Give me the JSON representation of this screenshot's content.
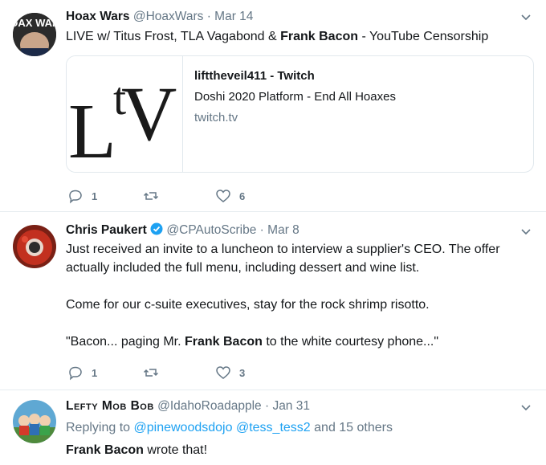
{
  "tweets": [
    {
      "name": "Hoax Wars",
      "handle": "@HoaxWars",
      "sep": "·",
      "date": "Mar 14",
      "avatar_text": "HOAX WARS",
      "text_parts": [
        "LIVE w/ Titus Frost, TLA Vagabond & ",
        "Frank Bacon",
        " - YouTube Censorship"
      ],
      "card": {
        "logo_text": "LtV",
        "title": "lifttheveil411 - Twitch",
        "description": "Doshi 2020 Platform - End All Hoaxes",
        "domain": "twitch.tv"
      },
      "replies": "1",
      "retweets": "",
      "likes": "6"
    },
    {
      "name": "Chris Paukert",
      "verified": true,
      "handle": "@CPAutoScribe",
      "sep": "·",
      "date": "Mar 8",
      "paragraphs": [
        "Just received an invite to a luncheon to interview a supplier's CEO. The offer actually included the full menu, including dessert and wine list.",
        "Come for our c-suite executives, stay for the rock shrimp risotto."
      ],
      "quote_parts": [
        "\"Bacon... paging Mr. ",
        "Frank Bacon",
        " to the white courtesy phone...\""
      ],
      "replies": "1",
      "retweets": "",
      "likes": "3"
    },
    {
      "name": "Lefty Mob Bob",
      "handle": "@IdahoRoadapple",
      "sep": "·",
      "date": "Jan 31",
      "reply_prefix": "Replying to",
      "reply_to": [
        "@pinewoodsdojo",
        "@tess_tess2"
      ],
      "reply_suffix": "and 15 others",
      "text_parts": [
        "Frank Bacon",
        " wrote that!"
      ]
    }
  ],
  "colors": {
    "link": "#1da1f2",
    "muted": "#657786",
    "text": "#14171a",
    "verified": "#1da1f2"
  },
  "icons": [
    "reply-icon",
    "retweet-icon",
    "like-icon",
    "chevron-down-icon",
    "verified-badge-icon"
  ]
}
